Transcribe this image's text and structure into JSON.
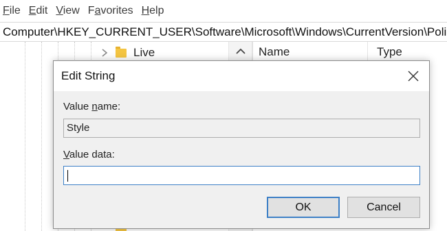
{
  "menu": {
    "file": {
      "accel": "F",
      "rest": "ile"
    },
    "edit": {
      "accel": "E",
      "rest": "dit"
    },
    "view": {
      "accel": "V",
      "rest": "iew"
    },
    "favorites": {
      "pre": "F",
      "accel": "a",
      "rest": "vorites"
    },
    "help": {
      "accel": "H",
      "rest": "elp"
    }
  },
  "address_bar": {
    "path": "Computer\\HKEY_CURRENT_USER\\Software\\Microsoft\\Windows\\CurrentVersion\\Polic"
  },
  "tree": {
    "visible_item": {
      "label": "Live",
      "icon": "folder-icon",
      "expander": "chevron-right-icon"
    }
  },
  "values_pane": {
    "columns": [
      "Name",
      "Type"
    ]
  },
  "dialog": {
    "title": "Edit String",
    "value_name_label": {
      "pre": "Value ",
      "accel": "n",
      "rest": "ame:"
    },
    "value_name": "Style",
    "value_data_label": {
      "accel": "V",
      "rest": "alue data:"
    },
    "value_data": "",
    "ok_label": "OK",
    "cancel_label": "Cancel"
  },
  "colors": {
    "focus_blue": "#3c7fc6",
    "dialog_bg": "#f0f0f0",
    "folder_yellow": "#f4c542"
  }
}
